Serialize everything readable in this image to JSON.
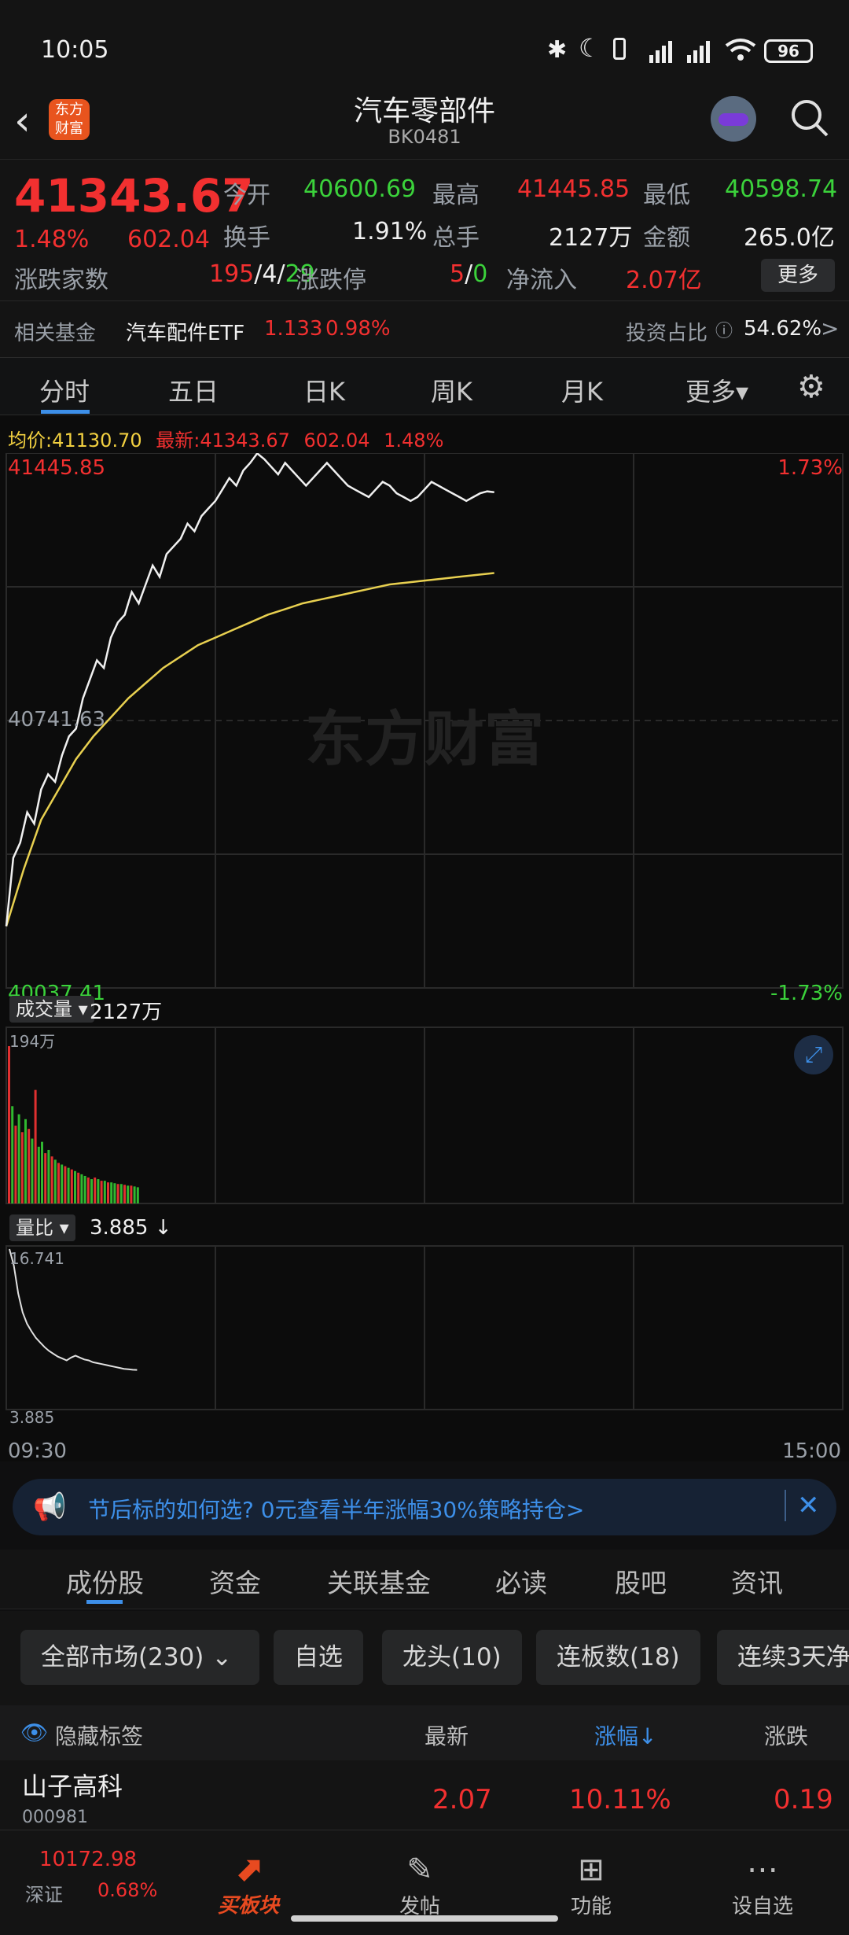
{
  "status": {
    "time": "10:05",
    "battery": "96"
  },
  "header": {
    "logo_top": "东方",
    "logo_bottom": "财富",
    "title": "汽车零部件",
    "code": "BK0481"
  },
  "quote": {
    "price": "41343.67",
    "pct": "1.48%",
    "chg": "602.04",
    "open_label": "今开",
    "open": "40600.69",
    "high_label": "最高",
    "high": "41445.85",
    "low_label": "最低",
    "low": "40598.74",
    "turnover_label": "换手",
    "turnover": "1.91%",
    "vol_label": "总手",
    "vol": "2127万",
    "amt_label": "金额",
    "amt": "265.0亿",
    "updown_label": "涨跌家数",
    "up": "195",
    "flat": "4",
    "down": "29",
    "slash1": "/",
    "slash2": "/",
    "limit_label": "涨跌停",
    "limit_up": "5",
    "limit_down": "0",
    "inflow_label": "净流入",
    "inflow": "2.07亿",
    "more": "更多"
  },
  "fund": {
    "label": "相关基金",
    "name": "汽车配件ETF",
    "price": "1.133",
    "pct": "0.98%",
    "ratio_label": "投资占比",
    "ratio": "54.62%",
    "arrow": ">"
  },
  "tabs": [
    "分时",
    "五日",
    "日K",
    "周K",
    "月K",
    "更多▾"
  ],
  "legend": {
    "avg_label": "均价:",
    "avg": "41130.70",
    "latest_label": "最新:",
    "latest": "41343.67",
    "chg": "602.04",
    "pct": "1.48%"
  },
  "axis": {
    "top": "41445.85",
    "top_pct": "1.73%",
    "mid": "40741.63",
    "bottom": "40037.41",
    "bottom_pct": "-1.73%",
    "time_start": "09:30",
    "time_end": "15:00"
  },
  "watermark": "东方财富",
  "vol_panel": {
    "label": "成交量",
    "value": "2127万",
    "max": "194万"
  },
  "ratio_panel": {
    "label": "量比",
    "value": "3.885 ↓",
    "max": "16.741",
    "min": "3.885"
  },
  "chart_data": {
    "type": "line",
    "series": [
      {
        "name": "最新",
        "x_minutes": [
          0,
          2,
          4,
          6,
          8,
          10,
          12,
          14,
          16,
          18,
          20,
          22,
          24,
          26,
          28,
          30,
          32,
          34,
          36,
          38,
          40,
          42,
          44,
          46,
          48,
          50,
          52,
          54,
          56,
          58,
          60,
          62,
          64,
          66,
          68,
          70,
          72,
          74,
          76,
          78,
          80,
          82,
          84,
          86,
          88,
          90,
          92,
          94,
          96,
          98,
          100,
          102,
          104,
          106,
          108,
          110,
          112,
          114,
          116,
          118,
          120,
          122,
          124,
          126,
          128,
          130,
          132,
          134,
          136,
          138,
          140
        ],
        "values": [
          40200,
          40380,
          40420,
          40500,
          40470,
          40560,
          40600,
          40580,
          40650,
          40700,
          40720,
          40800,
          40850,
          40900,
          40880,
          40960,
          41000,
          41020,
          41080,
          41050,
          41100,
          41150,
          41120,
          41180,
          41200,
          41220,
          41260,
          41240,
          41280,
          41300,
          41320,
          41350,
          41380,
          41360,
          41400,
          41420,
          41445,
          41430,
          41410,
          41390,
          41420,
          41400,
          41380,
          41360,
          41380,
          41400,
          41420,
          41400,
          41380,
          41360,
          41350,
          41340,
          41330,
          41350,
          41370,
          41360,
          41340,
          41330,
          41320,
          41330,
          41350,
          41370,
          41360,
          41350,
          41340,
          41330,
          41320,
          41330,
          41340,
          41345,
          41343
        ]
      },
      {
        "name": "均价",
        "x_minutes": [
          0,
          5,
          10,
          15,
          20,
          25,
          30,
          35,
          40,
          45,
          50,
          55,
          60,
          65,
          70,
          75,
          80,
          85,
          90,
          95,
          100,
          105,
          110,
          115,
          120,
          125,
          130,
          135,
          140
        ],
        "values": [
          40200,
          40350,
          40480,
          40560,
          40640,
          40700,
          40750,
          40800,
          40840,
          40880,
          40910,
          40940,
          40960,
          40980,
          41000,
          41020,
          41035,
          41050,
          41060,
          41070,
          41080,
          41090,
          41100,
          41105,
          41110,
          41115,
          41120,
          41125,
          41130
        ]
      }
    ],
    "ylim": [
      40037.41,
      41445.85
    ],
    "x_range_minutes": [
      0,
      240
    ]
  },
  "vol_bars": [
    194,
    120,
    96,
    110,
    88,
    104,
    92,
    80,
    140,
    70,
    76,
    62,
    66,
    58,
    54,
    50,
    48,
    46,
    44,
    42,
    40,
    38,
    36,
    34,
    32,
    30,
    32,
    30,
    28,
    28,
    26,
    26,
    25,
    24,
    24,
    23,
    22,
    22,
    21,
    20
  ],
  "vol_colors": [
    "r",
    "g",
    "r",
    "g",
    "r",
    "g",
    "r",
    "g",
    "r",
    "g",
    "g",
    "r",
    "g",
    "r",
    "g",
    "r",
    "g",
    "r",
    "g",
    "r",
    "g",
    "r",
    "g",
    "g",
    "r",
    "g",
    "r",
    "g",
    "r",
    "g",
    "r",
    "g",
    "g",
    "r",
    "g",
    "r",
    "g",
    "r",
    "g",
    "g"
  ],
  "ratio_line": [
    16.741,
    15,
    12,
    10,
    8.8,
    8,
    7.3,
    6.8,
    6.3,
    5.9,
    5.6,
    5.3,
    5.1,
    4.9,
    5.2,
    5.4,
    5.2,
    5.0,
    4.9,
    4.7,
    4.6,
    4.5,
    4.4,
    4.3,
    4.2,
    4.1,
    4.0,
    3.95,
    3.9,
    3.885
  ],
  "banner": {
    "text": "节后标的如何选? 0元查看半年涨幅30%策略持仓>"
  },
  "btabs": [
    "成份股",
    "资金",
    "关联基金",
    "必读",
    "股吧",
    "资讯"
  ],
  "filters": [
    "全部市场(230)",
    "自选",
    "龙头(10)",
    "连板数(18)",
    "连续3天净"
  ],
  "listhdr": {
    "hide": "隐藏标签",
    "latest": "最新",
    "pct": "涨幅↓",
    "chg": "涨跌"
  },
  "rows": [
    {
      "name": "山子高科",
      "code": "000981",
      "price": "2.07",
      "pct": "10.11%",
      "chg": "0.19"
    }
  ],
  "bottom": {
    "index": "10172.98",
    "index_name": "深证",
    "index_pct": "0.68%",
    "items": [
      "买板块",
      "发帖",
      "功能",
      "设自选"
    ]
  }
}
